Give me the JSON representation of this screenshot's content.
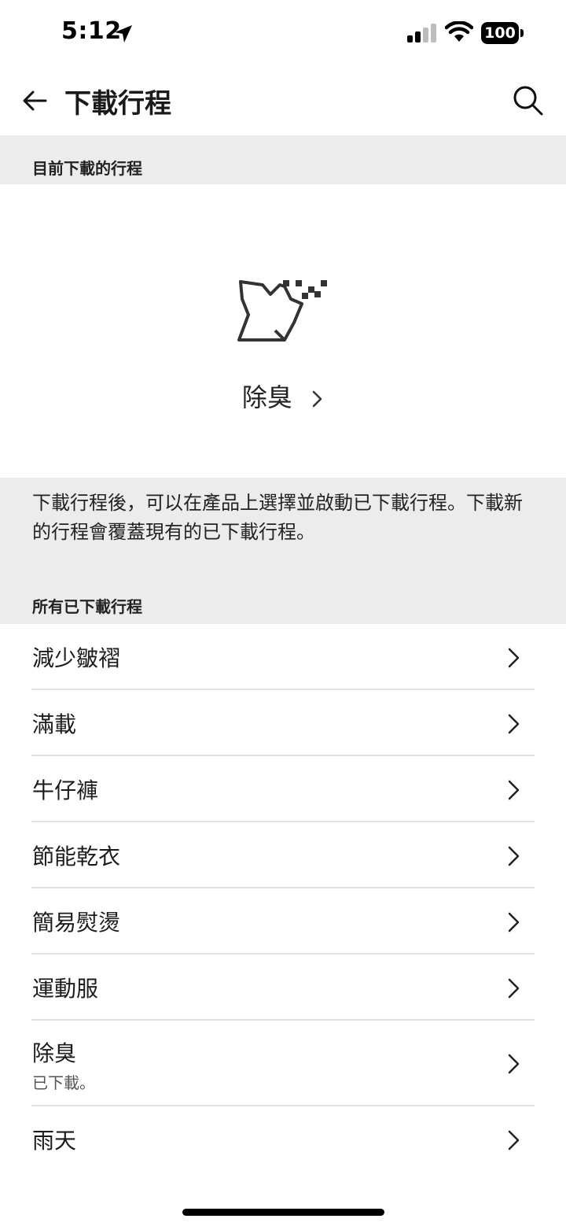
{
  "status_bar": {
    "time": "5:12",
    "battery": "100"
  },
  "header": {
    "title": "下載行程",
    "back_icon": "arrow-left-icon",
    "search_icon": "search-icon"
  },
  "current_section": {
    "title": "目前下載的行程",
    "program_icon": "deodorize-shirt-icon",
    "program_name": "除臭"
  },
  "info": {
    "text": "下載行程後，可以在產品上選擇並啟動已下載行程。下載新的行程會覆蓋現有的已下載行程。"
  },
  "all_section": {
    "title": "所有已下載行程",
    "items": [
      {
        "label": "減少皺褶",
        "sub": ""
      },
      {
        "label": "滿載",
        "sub": ""
      },
      {
        "label": "牛仔褲",
        "sub": ""
      },
      {
        "label": "節能乾衣",
        "sub": ""
      },
      {
        "label": "簡易熨燙",
        "sub": ""
      },
      {
        "label": "運動服",
        "sub": ""
      },
      {
        "label": "除臭",
        "sub": "已下載。"
      },
      {
        "label": "雨天",
        "sub": ""
      }
    ]
  }
}
